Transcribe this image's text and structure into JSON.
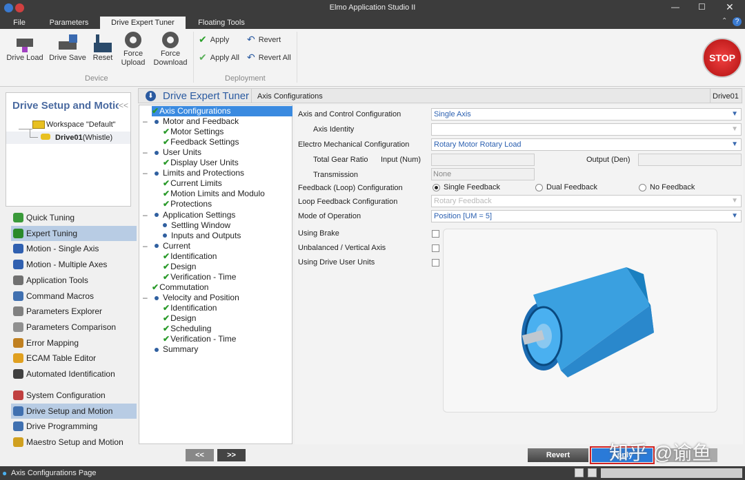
{
  "window": {
    "title": "Elmo Application Studio II"
  },
  "menu": {
    "tabs": [
      "File",
      "Parameters",
      "Drive Expert Tuner",
      "Floating Tools"
    ],
    "active": "Drive Expert Tuner"
  },
  "ribbon": {
    "device": {
      "group": "Device",
      "buttons": [
        {
          "label": "Drive Load"
        },
        {
          "label": "Drive Save"
        },
        {
          "label": "Reset"
        },
        {
          "label": "Force Upload"
        },
        {
          "label": "Force Download"
        }
      ]
    },
    "deployment": {
      "group": "Deployment",
      "apply": "Apply",
      "apply_all": "Apply All",
      "revert": "Revert",
      "revert_all": "Revert All"
    },
    "stop": "STOP"
  },
  "left": {
    "title": "Drive Setup and Motion",
    "collapse": "<<",
    "workspace": "Workspace \"Default\"",
    "drive_name": "Drive01",
    "drive_model": "(Whistle)",
    "nav": [
      {
        "label": "Quick Tuning",
        "color": "#3a9a3a"
      },
      {
        "label": "Expert Tuning",
        "color": "#2a8a2a",
        "selected": true
      },
      {
        "label": "Motion - Single Axis",
        "color": "#3060b0"
      },
      {
        "label": "Motion - Multiple Axes",
        "color": "#3060b0"
      },
      {
        "label": "Application Tools",
        "color": "#707070"
      },
      {
        "label": "Command Macros",
        "color": "#4070b0"
      },
      {
        "label": "Parameters Explorer",
        "color": "#808080"
      },
      {
        "label": "Parameters Comparison",
        "color": "#909090"
      },
      {
        "label": "Error Mapping",
        "color": "#c08020"
      },
      {
        "label": "ECAM Table Editor",
        "color": "#e0a020"
      },
      {
        "label": "Automated Identification",
        "color": "#404040"
      }
    ],
    "nav2": [
      {
        "label": "System Configuration",
        "color": "#c04040"
      },
      {
        "label": "Drive Setup and Motion",
        "color": "#4070b0",
        "selected": true
      },
      {
        "label": "Drive Programming",
        "color": "#4070b0"
      },
      {
        "label": "Maestro Setup and Motion",
        "color": "#d0a020"
      }
    ]
  },
  "header": {
    "title": "Drive Expert Tuner",
    "page": "Axis Configurations",
    "drive": "Drive01"
  },
  "tree": [
    {
      "label": "Axis Configurations",
      "type": "check",
      "level": 0,
      "selected": true
    },
    {
      "label": "Motor and Feedback",
      "type": "section"
    },
    {
      "label": "Motor Settings",
      "type": "check",
      "level": 1
    },
    {
      "label": "Feedback Settings",
      "type": "check",
      "level": 1
    },
    {
      "label": "User Units",
      "type": "section"
    },
    {
      "label": "Display User Units",
      "type": "check",
      "level": 1
    },
    {
      "label": "Limits and Protections",
      "type": "section"
    },
    {
      "label": "Current Limits",
      "type": "check",
      "level": 1
    },
    {
      "label": "Motion Limits and Modulo",
      "type": "check",
      "level": 1
    },
    {
      "label": "Protections",
      "type": "check",
      "level": 1
    },
    {
      "label": "Application Settings",
      "type": "section"
    },
    {
      "label": "Settling Window",
      "type": "dot",
      "level": 1
    },
    {
      "label": "Inputs and Outputs",
      "type": "dot",
      "level": 1
    },
    {
      "label": "Current",
      "type": "section"
    },
    {
      "label": "Identification",
      "type": "check",
      "level": 1
    },
    {
      "label": "Design",
      "type": "check",
      "level": 1
    },
    {
      "label": "Verification - Time",
      "type": "check",
      "level": 1
    },
    {
      "label": "Commutation",
      "type": "check",
      "level": 0
    },
    {
      "label": "Velocity and Position",
      "type": "section"
    },
    {
      "label": "Identification",
      "type": "check",
      "level": 1
    },
    {
      "label": "Design",
      "type": "check",
      "level": 1
    },
    {
      "label": "Scheduling",
      "type": "check",
      "level": 1
    },
    {
      "label": "Verification - Time",
      "type": "check",
      "level": 1
    },
    {
      "label": "Summary",
      "type": "leafsection"
    }
  ],
  "tree_nav": {
    "prev": "<<",
    "next": ">>"
  },
  "form": {
    "axis_control": {
      "label": "Axis and Control Configuration",
      "value": "Single Axis"
    },
    "axis_identity": {
      "label": "Axis Identity",
      "value": ""
    },
    "electro_mech": {
      "label": "Electro Mechanical Configuration",
      "value": "Rotary Motor Rotary Load"
    },
    "gear": {
      "label": "Total Gear Ratio",
      "input_label": "Input (Num)",
      "output_label": "Output (Den)",
      "input": "",
      "output": ""
    },
    "transmission": {
      "label": "Transmission",
      "value": "None"
    },
    "feedback": {
      "label": "Feedback (Loop) Configuration",
      "options": [
        "Single Feedback",
        "Dual Feedback",
        "No Feedback"
      ],
      "selected": "Single Feedback"
    },
    "loop_feedback": {
      "label": "Loop Feedback Configuration",
      "value": "Rotary Feedback"
    },
    "mode": {
      "label": "Mode of Operation",
      "value": "Position [UM = 5]"
    },
    "brake": {
      "label": "Using Brake",
      "checked": false
    },
    "unbalanced": {
      "label": "Unbalanced / Vertical Axis",
      "checked": false
    },
    "user_units": {
      "label": "Using Drive User Units",
      "checked": false
    }
  },
  "footer": {
    "revert": "Revert",
    "apply": "Apply",
    "third": ""
  },
  "watermark": "知乎 @谕鱼",
  "status": {
    "text": "Axis Configurations Page"
  }
}
